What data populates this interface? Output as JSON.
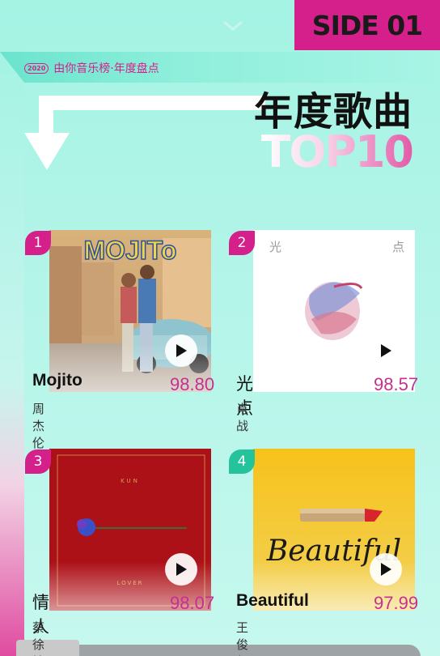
{
  "header": {
    "side_label": "SIDE 01",
    "year_badge": "2020",
    "subtitle": "由你音乐榜·年度盘点",
    "title_main": "年度歌曲",
    "title_top": "TOP10"
  },
  "colors": {
    "accent_pink": "#d5208c",
    "accent_teal": "#25c39c",
    "background": "#a4f3e3"
  },
  "songs": [
    {
      "rank": "1",
      "title": "Mojito",
      "score": "98.80",
      "artist": "周杰伦",
      "cover_text": "MOJITo"
    },
    {
      "rank": "2",
      "title": "光点",
      "score": "98.57",
      "artist": "肖战",
      "cover_text_left": "光",
      "cover_text_right": "点"
    },
    {
      "rank": "3",
      "title": "情人",
      "score": "98.07",
      "artist": "蔡徐坤",
      "cover_text": "KUN",
      "cover_text_bottom": "LOVER"
    },
    {
      "rank": "4",
      "title": "Beautiful",
      "score": "97.99",
      "artist": "王俊凯",
      "cover_text": "Beautiful"
    }
  ],
  "icons": [
    "play-icon",
    "chevron-down-icon",
    "arrow-down-icon"
  ]
}
